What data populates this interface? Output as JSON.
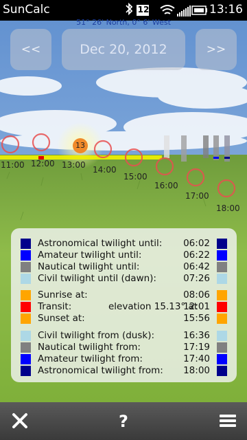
{
  "statusbar": {
    "app_name": "SunCalc",
    "notification_count": "12",
    "time": "13:16"
  },
  "location": "51° 26' North, 0° 6' West",
  "nav": {
    "prev_label": "<<",
    "date": "Dec 20, 2012",
    "next_label": ">>"
  },
  "sun_marker_label": "13",
  "hours": [
    "11:00",
    "12:00",
    "13:00",
    "14:00",
    "15:00",
    "16:00",
    "17:00",
    "18:00"
  ],
  "twilight_rows": [
    {
      "label": "Astronomical twilight until:",
      "value": "06:02",
      "color": "#00008b"
    },
    {
      "label": "Amateur twilight until:",
      "value": "06:22",
      "color": "#0000ff"
    },
    {
      "label": "Nautical twilight until:",
      "value": "06:42",
      "color": "#808080"
    },
    {
      "label": "Civil twilight until (dawn):",
      "value": "07:26",
      "color": "#add8e6"
    }
  ],
  "sun_rows": [
    {
      "label": "Sunrise at:",
      "value": "08:06",
      "color": "#ffa500"
    },
    {
      "label": "Transit:",
      "extra": "elevation 15.13° at",
      "value": "12:01",
      "color": "#ff0000"
    },
    {
      "label": "Sunset at:",
      "value": "15:56",
      "color": "#ffa500"
    }
  ],
  "dusk_rows": [
    {
      "label": "Civil twilight from (dusk):",
      "value": "16:36",
      "color": "#add8e6"
    },
    {
      "label": "Nautical twilight from:",
      "value": "17:19",
      "color": "#808080"
    },
    {
      "label": "Amateur twilight from:",
      "value": "17:40",
      "color": "#0000ff"
    },
    {
      "label": "Astronomical twilight from:",
      "value": "18:00",
      "color": "#00008b"
    }
  ],
  "toolbar": {
    "close_icon": "close-icon",
    "help_icon": "help-icon",
    "menu_icon": "menu-icon"
  },
  "colors": {
    "sun_orange": "#f08a2a",
    "path_yellow": "#f2f200",
    "circle_red": "#e85050"
  }
}
